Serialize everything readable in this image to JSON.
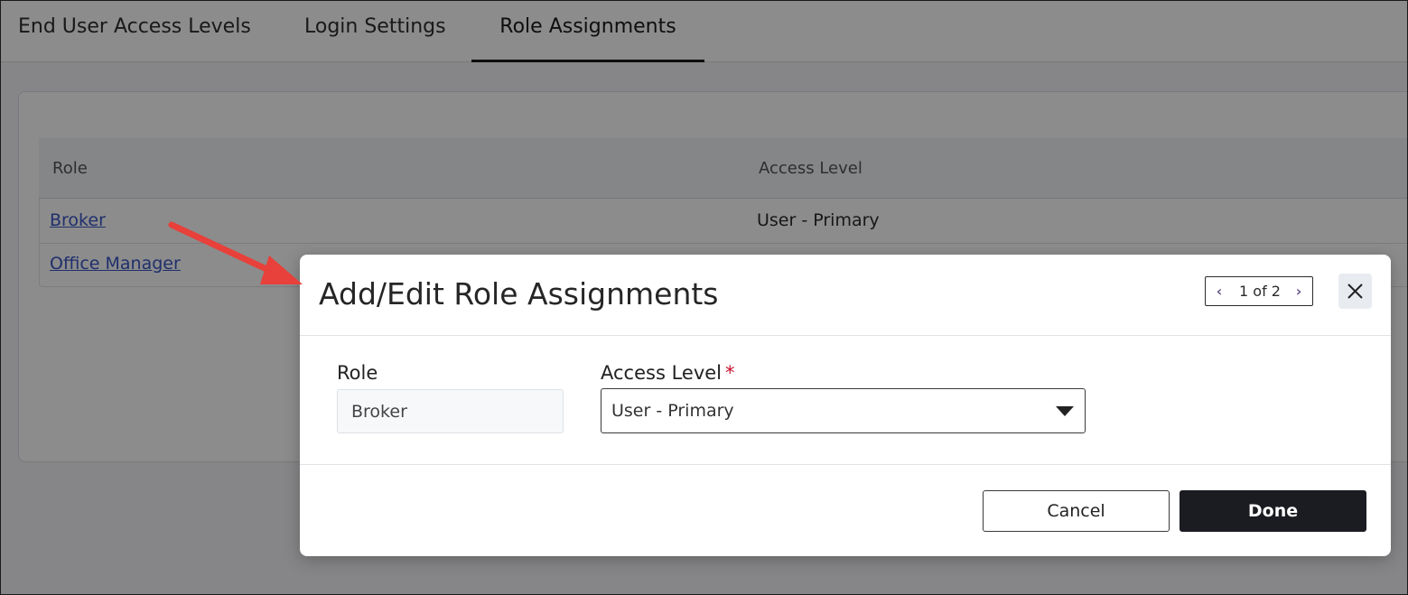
{
  "tabs": [
    {
      "label": "End User Access Levels",
      "active": false
    },
    {
      "label": "Login Settings",
      "active": false
    },
    {
      "label": "Role Assignments",
      "active": true
    }
  ],
  "table": {
    "columns": [
      "Role",
      "Access Level"
    ],
    "rows": [
      {
        "role": "Broker",
        "access_level": "User - Primary"
      },
      {
        "role": "Office Manager",
        "access_level": ""
      }
    ]
  },
  "modal": {
    "title": "Add/Edit Role Assignments",
    "pager": {
      "text": "1 of 2",
      "prev_icon": "chevron-left-icon",
      "next_icon": "chevron-right-icon"
    },
    "close_icon": "close-icon",
    "fields": {
      "role": {
        "label": "Role",
        "value": "Broker"
      },
      "access_level": {
        "label": "Access Level",
        "required_marker": "*",
        "value": "User - Primary",
        "icon": "caret-down-icon"
      }
    },
    "buttons": {
      "cancel": "Cancel",
      "done": "Done"
    }
  },
  "annotation": {
    "icon": "red-arrow-icon",
    "color": "#e8403a"
  },
  "colors": {
    "link": "#3a56c5",
    "required": "#c8102e",
    "primary_button": "#1b1c22"
  }
}
